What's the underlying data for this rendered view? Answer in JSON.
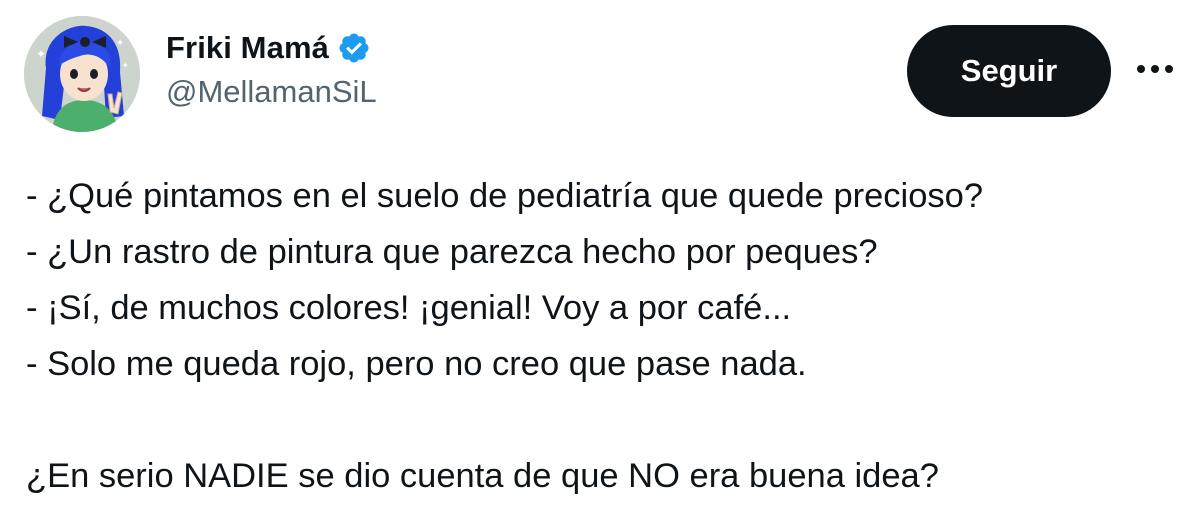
{
  "author": {
    "display_name": "Friki Mamá",
    "handle": "@MellamanSiL",
    "verified": true,
    "avatar_icon": "cartoon-avatar-blue-hair"
  },
  "actions": {
    "follow_label": "Seguir",
    "more_icon": "ellipsis-icon"
  },
  "tweet": {
    "lines": [
      "- ¿Qué pintamos en el suelo de pediatría que quede precioso?",
      "- ¿Un rastro de pintura que parezca hecho por peques?",
      "- ¡Sí, de muchos colores! ¡genial! Voy a por café...",
      "- Solo me queda rojo, pero no creo que pase nada."
    ],
    "closing": "¿En serio NADIE se dio cuenta de que NO era buena idea?"
  },
  "colors": {
    "verified_badge": "#1d9bf0",
    "follow_button_bg": "#0f1419",
    "text_primary": "#0f1419",
    "text_secondary": "#536471"
  }
}
